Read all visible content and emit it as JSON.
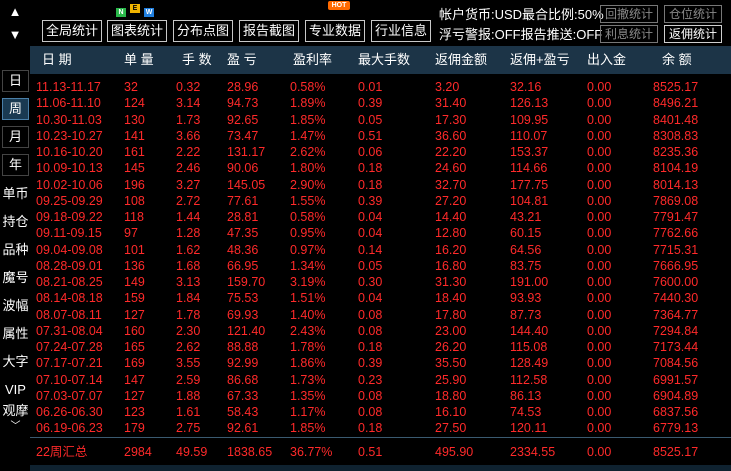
{
  "nav": {
    "up_arrow": "▲",
    "down_arrow": "▼"
  },
  "toolbar": {
    "buttons": [
      "全局统计",
      "图表统计",
      "分布点图",
      "报告截图",
      "专业数据",
      "行业信息"
    ],
    "badges": {
      "n": "N",
      "e": "E",
      "w": "W",
      "hot": "HOT"
    },
    "account_currency": "帐户货币:USD最合比例:50%",
    "float_loss": "浮亏警报:OFF报告推送:OFF",
    "right_buttons": [
      "回撤统计",
      "仓位统计",
      "利息统计",
      "返佣统计"
    ]
  },
  "side_tabs": [
    "日",
    "周",
    "月",
    "年",
    "单币",
    "持仓",
    "品种",
    "魔号",
    "波幅",
    "属性",
    "大字",
    "VIP",
    "观摩"
  ],
  "side_more": "﹀",
  "table": {
    "headers": [
      "日 期",
      "单 量",
      "手 数",
      "盈 亏",
      "盈利率",
      "最大手数",
      "返佣金额",
      "返佣+盈亏",
      "出入金",
      "余 额"
    ],
    "rows": [
      [
        "11.13-11.17",
        "32",
        "0.32",
        "28.96",
        "0.58%",
        "0.01",
        "3.20",
        "32.16",
        "0.00",
        "8525.17"
      ],
      [
        "11.06-11.10",
        "124",
        "3.14",
        "94.73",
        "1.89%",
        "0.39",
        "31.40",
        "126.13",
        "0.00",
        "8496.21"
      ],
      [
        "10.30-11.03",
        "130",
        "1.73",
        "92.65",
        "1.85%",
        "0.05",
        "17.30",
        "109.95",
        "0.00",
        "8401.48"
      ],
      [
        "10.23-10.27",
        "141",
        "3.66",
        "73.47",
        "1.47%",
        "0.51",
        "36.60",
        "110.07",
        "0.00",
        "8308.83"
      ],
      [
        "10.16-10.20",
        "161",
        "2.22",
        "131.17",
        "2.62%",
        "0.06",
        "22.20",
        "153.37",
        "0.00",
        "8235.36"
      ],
      [
        "10.09-10.13",
        "145",
        "2.46",
        "90.06",
        "1.80%",
        "0.18",
        "24.60",
        "114.66",
        "0.00",
        "8104.19"
      ],
      [
        "10.02-10.06",
        "196",
        "3.27",
        "145.05",
        "2.90%",
        "0.18",
        "32.70",
        "177.75",
        "0.00",
        "8014.13"
      ],
      [
        "09.25-09.29",
        "108",
        "2.72",
        "77.61",
        "1.55%",
        "0.39",
        "27.20",
        "104.81",
        "0.00",
        "7869.08"
      ],
      [
        "09.18-09.22",
        "118",
        "1.44",
        "28.81",
        "0.58%",
        "0.04",
        "14.40",
        "43.21",
        "0.00",
        "7791.47"
      ],
      [
        "09.11-09.15",
        "97",
        "1.28",
        "47.35",
        "0.95%",
        "0.04",
        "12.80",
        "60.15",
        "0.00",
        "7762.66"
      ],
      [
        "09.04-09.08",
        "101",
        "1.62",
        "48.36",
        "0.97%",
        "0.14",
        "16.20",
        "64.56",
        "0.00",
        "7715.31"
      ],
      [
        "08.28-09.01",
        "136",
        "1.68",
        "66.95",
        "1.34%",
        "0.05",
        "16.80",
        "83.75",
        "0.00",
        "7666.95"
      ],
      [
        "08.21-08.25",
        "149",
        "3.13",
        "159.70",
        "3.19%",
        "0.30",
        "31.30",
        "191.00",
        "0.00",
        "7600.00"
      ],
      [
        "08.14-08.18",
        "159",
        "1.84",
        "75.53",
        "1.51%",
        "0.04",
        "18.40",
        "93.93",
        "0.00",
        "7440.30"
      ],
      [
        "08.07-08.11",
        "127",
        "1.78",
        "69.93",
        "1.40%",
        "0.08",
        "17.80",
        "87.73",
        "0.00",
        "7364.77"
      ],
      [
        "07.31-08.04",
        "160",
        "2.30",
        "121.40",
        "2.43%",
        "0.08",
        "23.00",
        "144.40",
        "0.00",
        "7294.84"
      ],
      [
        "07.24-07.28",
        "165",
        "2.62",
        "88.88",
        "1.78%",
        "0.18",
        "26.20",
        "115.08",
        "0.00",
        "7173.44"
      ],
      [
        "07.17-07.21",
        "169",
        "3.55",
        "92.99",
        "1.86%",
        "0.39",
        "35.50",
        "128.49",
        "0.00",
        "7084.56"
      ],
      [
        "07.10-07.14",
        "147",
        "2.59",
        "86.68",
        "1.73%",
        "0.23",
        "25.90",
        "112.58",
        "0.00",
        "6991.57"
      ],
      [
        "07.03-07.07",
        "127",
        "1.88",
        "67.33",
        "1.35%",
        "0.08",
        "18.80",
        "86.13",
        "0.00",
        "6904.89"
      ],
      [
        "06.26-06.30",
        "123",
        "1.61",
        "58.43",
        "1.17%",
        "0.08",
        "16.10",
        "74.53",
        "0.00",
        "6837.56"
      ],
      [
        "06.19-06.23",
        "179",
        "2.75",
        "92.61",
        "1.85%",
        "0.18",
        "27.50",
        "120.11",
        "0.00",
        "6779.13"
      ]
    ],
    "summary": [
      "22周汇总",
      "2984",
      "49.59",
      "1838.65",
      "36.77%",
      "0.51",
      "495.90",
      "2334.55",
      "0.00",
      "8525.17"
    ]
  },
  "colors": {
    "header_bg": "#1c3447",
    "profit": "#ff2a2a",
    "text": "#ffffff"
  }
}
